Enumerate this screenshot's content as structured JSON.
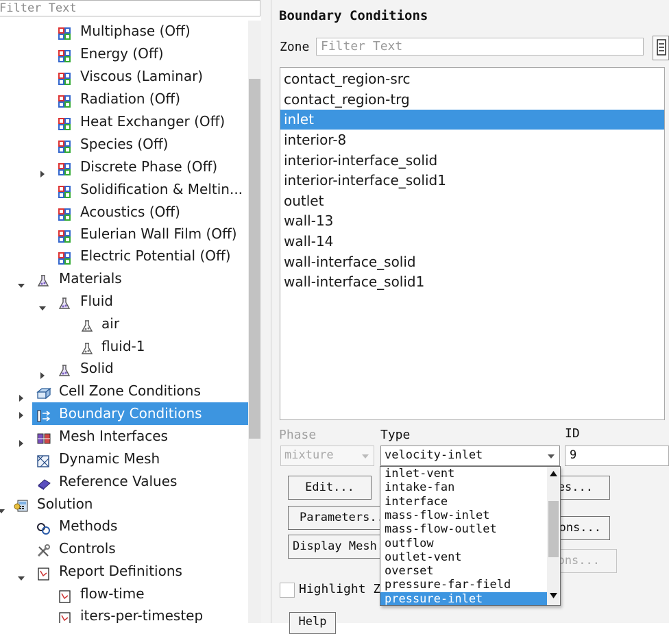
{
  "left_panel": {
    "filter_placeholder": "Filter Text",
    "tree": [
      {
        "label": "Multiphase (Off)",
        "icon": "model-grid-icon"
      },
      {
        "label": "Energy (Off)",
        "icon": "model-grid-icon"
      },
      {
        "label": "Viscous (Laminar)",
        "icon": "model-grid-icon"
      },
      {
        "label": "Radiation (Off)",
        "icon": "model-grid-icon"
      },
      {
        "label": "Heat Exchanger (Off)",
        "icon": "model-grid-icon"
      },
      {
        "label": "Species (Off)",
        "icon": "model-grid-icon"
      },
      {
        "label": "Discrete Phase (Off)",
        "icon": "model-grid-icon"
      },
      {
        "label": "Solidification & Meltin...",
        "icon": "model-grid-icon"
      },
      {
        "label": "Acoustics (Off)",
        "icon": "model-grid-icon"
      },
      {
        "label": "Eulerian Wall Film (Off)",
        "icon": "model-grid-icon"
      },
      {
        "label": "Electric Potential (Off)",
        "icon": "model-grid-icon"
      },
      {
        "label": "Materials",
        "icon": "flask-icon"
      },
      {
        "label": "Fluid",
        "icon": "flask-icon"
      },
      {
        "label": "air",
        "icon": "flask-icon"
      },
      {
        "label": "fluid-1",
        "icon": "flask-icon"
      },
      {
        "label": "Solid",
        "icon": "flask-icon"
      },
      {
        "label": "Cell Zone Conditions",
        "icon": "cell-zone-icon"
      },
      {
        "label": "Boundary Conditions",
        "icon": "boundary-conditions-icon"
      },
      {
        "label": "Mesh Interfaces",
        "icon": "mesh-interfaces-icon"
      },
      {
        "label": "Dynamic Mesh",
        "icon": "dynamic-mesh-icon"
      },
      {
        "label": "Reference Values",
        "icon": "reference-values-icon"
      },
      {
        "label": "Solution",
        "icon": "solution-icon"
      },
      {
        "label": "Methods",
        "icon": "methods-icon"
      },
      {
        "label": "Controls",
        "icon": "controls-icon"
      },
      {
        "label": "Report Definitions",
        "icon": "report-definitions-icon"
      },
      {
        "label": "flow-time",
        "icon": "report-icon"
      },
      {
        "label": "iters-per-timestep",
        "icon": "report-icon"
      }
    ]
  },
  "boundary_panel": {
    "title": "Boundary Conditions",
    "zone_label": "Zone",
    "zone_filter_placeholder": "Filter Text",
    "zones": [
      "contact_region-src",
      "contact_region-trg",
      "inlet",
      "interior-8",
      "interior-interface_solid",
      "interior-interface_solid1",
      "outlet",
      "wall-13",
      "wall-14",
      "wall-interface_solid",
      "wall-interface_solid1"
    ],
    "selected_zone": "inlet",
    "phase_label": "Phase",
    "phase_value": "mixture",
    "type_label": "Type",
    "type_value": "velocity-inlet",
    "id_label": "ID",
    "id_value": "9",
    "buttons": {
      "edit": "Edit...",
      "copy_partial": "es...",
      "parameters": "Parameters...",
      "operating_partial": "ons...",
      "display_mesh": "Display Mesh...",
      "disabled_partial": "ons..."
    },
    "highlight_label": "Highlight Z",
    "help_label": "Help",
    "type_options": [
      "inlet-vent",
      "intake-fan",
      "interface",
      "mass-flow-inlet",
      "mass-flow-outlet",
      "outflow",
      "outlet-vent",
      "overset",
      "pressure-far-field",
      "pressure-inlet"
    ],
    "highlighted_option": "pressure-inlet"
  },
  "colors": {
    "selection": "#3d95e0",
    "panel_bg": "#f3f3f3"
  }
}
